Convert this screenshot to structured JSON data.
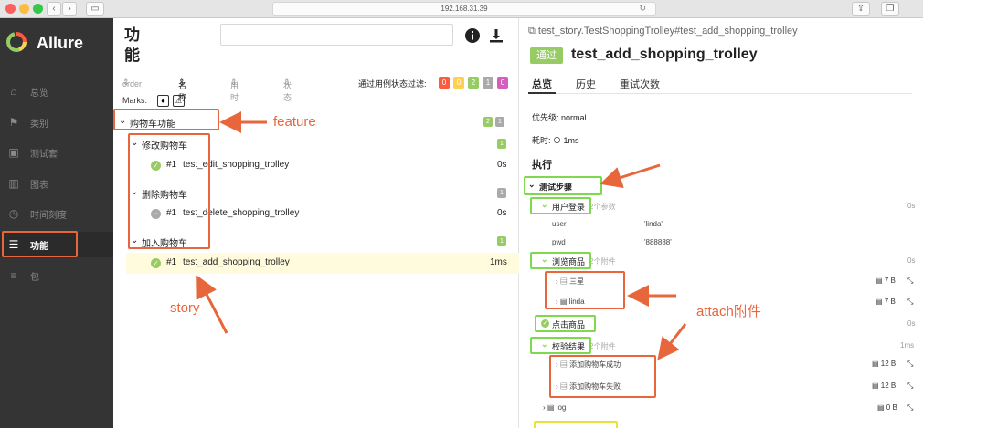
{
  "browser": {
    "url": "192.168.31.39"
  },
  "sidebar": {
    "brand": "Allure",
    "items": [
      {
        "label": "总览",
        "icon": "home-icon"
      },
      {
        "label": "类别",
        "icon": "flag-icon"
      },
      {
        "label": "测试套",
        "icon": "briefcase-icon"
      },
      {
        "label": "图表",
        "icon": "bar-chart-icon"
      },
      {
        "label": "时间刻度",
        "icon": "clock-icon"
      },
      {
        "label": "功能",
        "icon": "list-icon"
      },
      {
        "label": "包",
        "icon": "package-icon"
      }
    ]
  },
  "center": {
    "title": "功能",
    "sort": {
      "order": "order",
      "name": "名称",
      "duration": "用时",
      "status": "状态",
      "filter_label": "通过用例状态过滤:"
    },
    "status_counts": [
      {
        "value": "0",
        "color": "#fd5a3e"
      },
      {
        "value": "0",
        "color": "#ffd050"
      },
      {
        "value": "2",
        "color": "#97cc64"
      },
      {
        "value": "1",
        "color": "#aaaaaa"
      },
      {
        "value": "0",
        "color": "#d35ebe"
      }
    ],
    "marks_label": "Marks:",
    "feature": {
      "name": "购物车功能",
      "badge_passed": "2",
      "badge_skipped": "1"
    },
    "stories": [
      {
        "name": "修改购物车",
        "badge": "1",
        "badge_color": "#97cc64",
        "test": {
          "num": "#1",
          "name": "test_edit_shopping_trolley",
          "duration": "0s",
          "status": "passed"
        }
      },
      {
        "name": "删除购物车",
        "badge": "1",
        "badge_color": "#aaaaaa",
        "test": {
          "num": "#1",
          "name": "test_delete_shopping_trolley",
          "duration": "0s",
          "status": "skipped"
        }
      },
      {
        "name": "加入购物车",
        "badge": "1",
        "badge_color": "#97cc64",
        "test": {
          "num": "#1",
          "name": "test_add_shopping_trolley",
          "duration": "1ms",
          "status": "passed"
        }
      }
    ]
  },
  "right": {
    "path": "test_story.TestShoppingTrolley#test_add_shopping_trolley",
    "status_label": "通过",
    "test_name": "test_add_shopping_trolley",
    "tabs": [
      "总览",
      "历史",
      "重试次数"
    ],
    "priority": "优先级: normal",
    "duration": "耗时: ⊙ 1ms",
    "execution_title": "执行",
    "steps_title": "测试步骤",
    "steps": {
      "login": {
        "name": "用户登录",
        "meta": "2个参数",
        "dur": "0s",
        "params": [
          {
            "key": "user",
            "value": "'linda'"
          },
          {
            "key": "pwd",
            "value": "'888888'"
          }
        ]
      },
      "browse": {
        "name": "浏览商品",
        "meta": "2个附件",
        "dur": "0s",
        "attachments": [
          {
            "name": "三星",
            "size": "7 B"
          },
          {
            "name": "linda",
            "size": "7 B"
          }
        ]
      },
      "click": {
        "name": "点击商品",
        "dur": "0s"
      },
      "verify": {
        "name": "校验结果",
        "meta": "2个附件",
        "dur": "1ms",
        "attachments": [
          {
            "name": "添加购物车成功",
            "size": "12 B"
          },
          {
            "name": "添加购物车失败",
            "size": "12 B"
          }
        ]
      },
      "log": {
        "name": "log",
        "size": "0 B"
      }
    }
  },
  "annotations": {
    "feature": "feature",
    "story": "story",
    "attach": "attach附件"
  }
}
